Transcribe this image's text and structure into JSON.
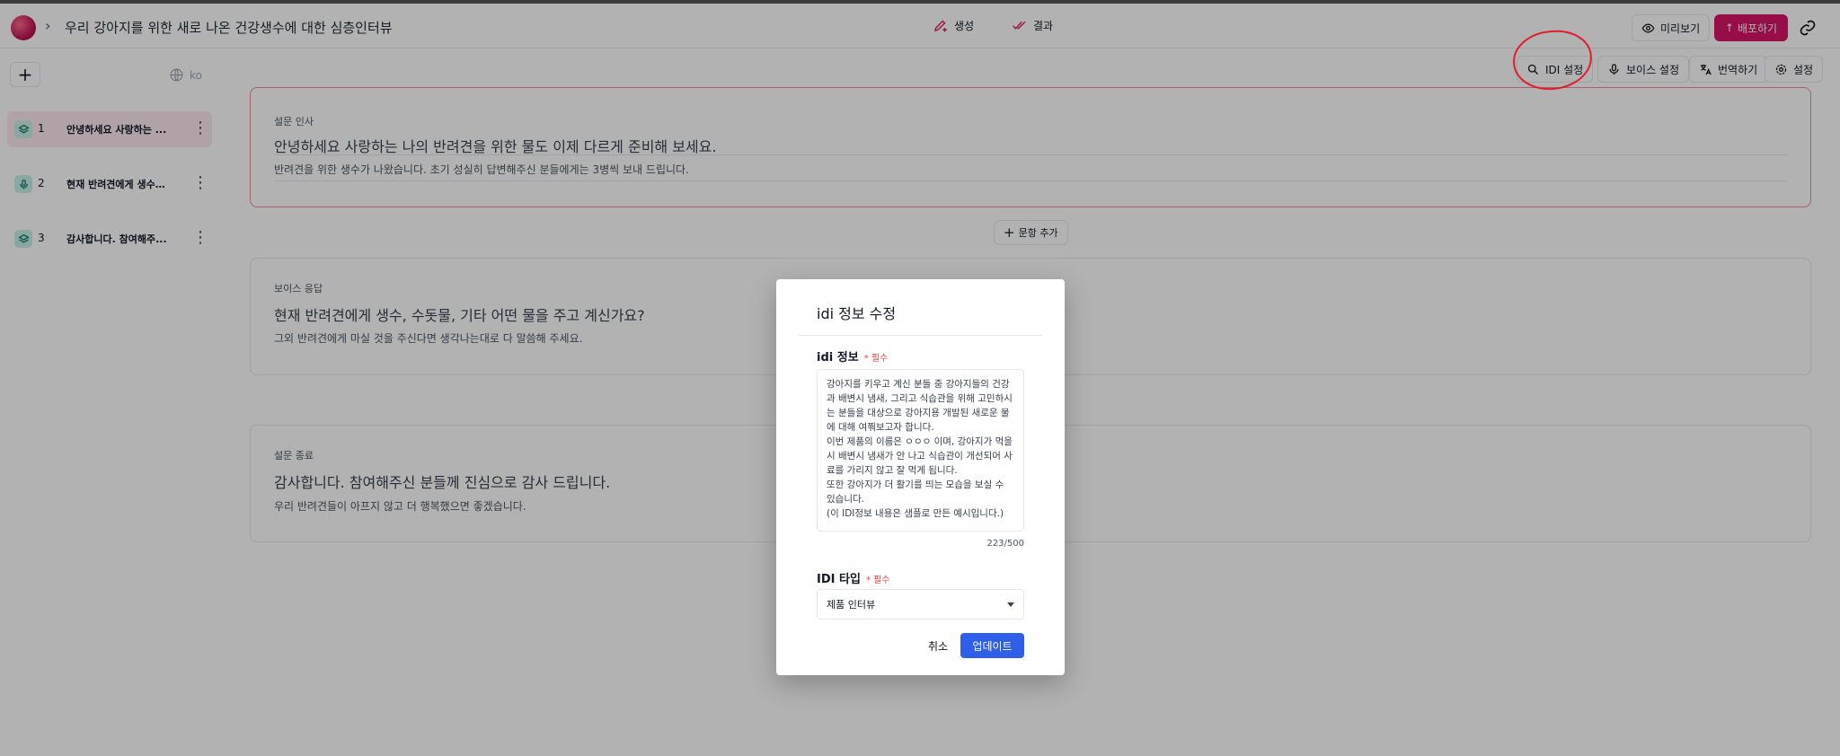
{
  "app": {
    "title": "우리 강아지를 위한 새로 나온 건강생수에 대한 심층인터뷰"
  },
  "nav": {
    "generate": "생성",
    "results": "결과"
  },
  "toolbar": {
    "preview": "미리보기",
    "publish": "배포하기",
    "idi_settings": "IDI 설정",
    "voice_settings": "보이스 설정",
    "translate": "번역하기",
    "settings": "설정"
  },
  "sidebar": {
    "language": "ko",
    "items": [
      {
        "num": "1",
        "label": "안녕하세요 사랑하는 ..."
      },
      {
        "num": "2",
        "label": "현재 반려견에게 생수,..."
      },
      {
        "num": "3",
        "label": "감사합니다. 참여해주..."
      }
    ]
  },
  "cards": [
    {
      "label": "설문 인사",
      "title": "안녕하세요 사랑하는 나의 반려견을 위한 물도 이제 다르게 준비해 보세요.",
      "sub": "반려견을 위한 생수가 나왔습니다. 초기 성실히 답변해주신 분들에게는 3병씩 보내 드립니다."
    },
    {
      "label": "보이스 응답",
      "title": "현재 반려견에게 생수, 수돗물, 기타 어떤 물을 주고 계신가요?",
      "sub": "그외 반려견에게 마실 것을 주신다면 생각나는대로 다 말씀해 주세요."
    },
    {
      "label": "설문 종료",
      "title": "감사합니다. 참여해주신 분들께 진심으로 감사 드립니다.",
      "sub": "우리 반려견들이 아프지 않고 더 행복했으면 좋겠습니다."
    }
  ],
  "add_sentence": "문항 추가",
  "modal": {
    "title": "idi 정보 수정",
    "info_label": "idi 정보",
    "required": "* 필수",
    "info_text": "강아지를 키우고 계신 분들 중 강아지들의 건강과 배변시 냄새, 그리고 식습관을 위해 고민하시는 분들을 대상으로 강아지용 개발된 새로운 물에 대해 여쭤보고자 합니다.\n이번 제품의 이름은 ㅇㅇㅇ 이며, 강아지가 먹을시 배변시 냄새가 안 나고 식습관이 개선되어 사료를 가리지 않고 잘 먹게 됩니다.\n또한 강아지가 더 활기를 띄는 모습을 보실 수 있습니다.\n(이 IDI정보 내용은 샘플로 만든 예시입니다.)",
    "char_count": "223/500",
    "type_label": "IDI 타입",
    "type_value": "제품 인터뷰",
    "cancel": "취소",
    "update": "업데이트"
  },
  "colors": {
    "brand": "#d91465",
    "primary_button": "#2f5ee8",
    "annotation": "#e11d2b"
  }
}
